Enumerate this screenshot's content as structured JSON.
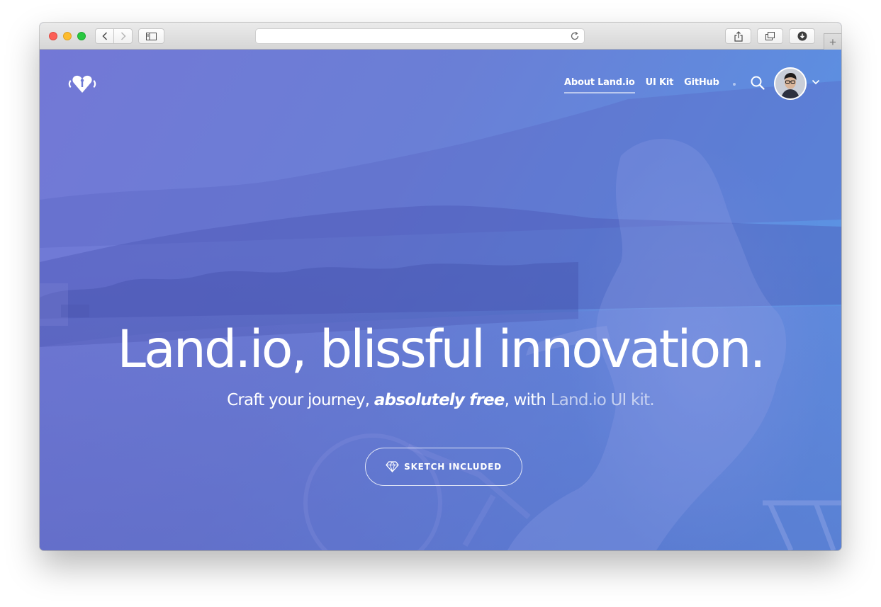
{
  "browser": {
    "address_text": "",
    "new_tab_label": "+",
    "icons": [
      "chevron-left-icon",
      "chevron-right-icon",
      "sidebar-icon",
      "reload-icon",
      "share-icon",
      "tabs-icon",
      "download-icon"
    ]
  },
  "site": {
    "logo_icon": "heart-logo-icon",
    "nav": [
      {
        "label": "About Land.io",
        "active": true
      },
      {
        "label": "UI Kit",
        "active": false
      },
      {
        "label": "GitHub",
        "active": false
      }
    ],
    "search_icon": "search-icon",
    "avatar_icon": "user-avatar",
    "menu_icon": "chevron-down-icon"
  },
  "hero": {
    "headline": "Land.io, blissful innovation.",
    "sub_part1": "Craft your journey, ",
    "sub_emphasis": "absolutely free",
    "sub_part2": ", with ",
    "sub_kit": "Land.io UI kit",
    "sub_end": ".",
    "cta_label": "SKETCH INCLUDED",
    "cta_icon": "diamond-icon"
  },
  "colors": {
    "gradient_start": "#7378d6",
    "gradient_end": "#5b9ae6",
    "text": "#ffffff"
  }
}
